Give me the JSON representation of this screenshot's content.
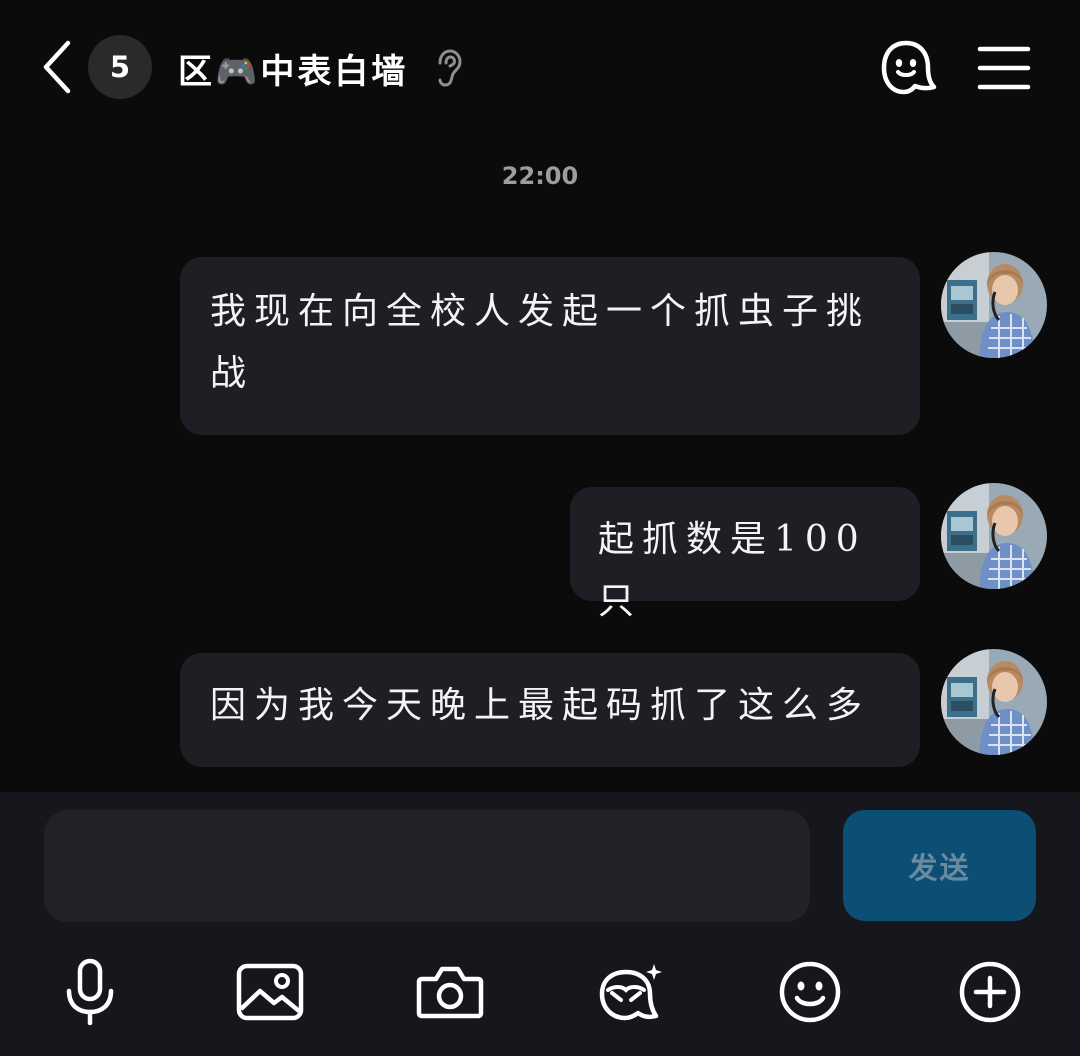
{
  "header": {
    "back_icon": "chevron-left-icon",
    "unread_count": "5",
    "title": "区🎮中表白墙",
    "ear_icon": "ear-icon",
    "ghost_icon": "ghost-icon",
    "menu_icon": "menu-icon"
  },
  "timestamp": "22:00",
  "messages": [
    {
      "text": "我现在向全校人发起一个抓虫子挑战",
      "sender": "self"
    },
    {
      "text": "起抓数是100只",
      "sender": "self"
    },
    {
      "text": "因为我今天晚上最起码抓了这么多",
      "sender": "self"
    }
  ],
  "composer": {
    "input_value": "",
    "send_label": "发送"
  },
  "toolbar": {
    "icons": [
      "microphone-icon",
      "image-icon",
      "camera-icon",
      "sticker-icon",
      "emoji-icon",
      "plus-icon"
    ]
  },
  "colors": {
    "background": "#0b0b0c",
    "bubble": "#1d1f24",
    "composer": "#15171c",
    "send_button": "#0d4f74"
  }
}
